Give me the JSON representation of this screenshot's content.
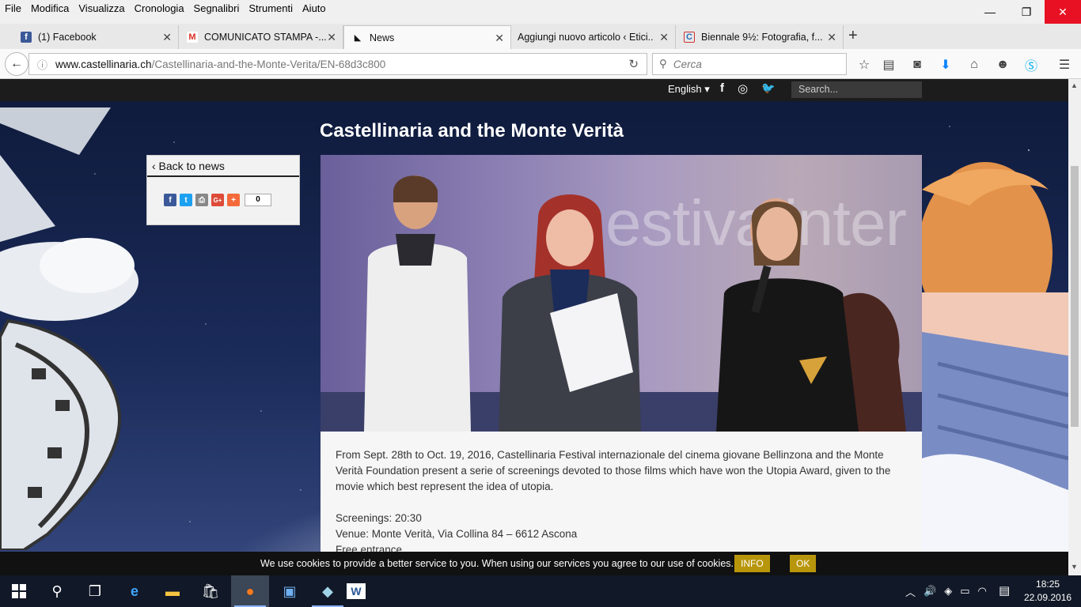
{
  "menubar": {
    "items": [
      "File",
      "Modifica",
      "Visualizza",
      "Cronologia",
      "Segnalibri",
      "Strumenti",
      "Aiuto"
    ]
  },
  "window_controls": {
    "minimize": "—",
    "maximize": "❐",
    "close": "✕"
  },
  "tabs": [
    {
      "title": "(1) Facebook",
      "favicon": "facebook-icon",
      "fav_glyph": "f",
      "fav_color": "#3b5998",
      "active": false
    },
    {
      "title": "COMUNICATO STAMPA -...",
      "favicon": "gmail-icon",
      "fav_glyph": "M",
      "fav_color": "#ffffff",
      "active": false
    },
    {
      "title": "News",
      "favicon": "castellinaria-icon",
      "fav_glyph": "◣",
      "fav_color": "#ffffff",
      "active": true
    },
    {
      "title": "Aggiungi nuovo articolo ‹ Etici...",
      "favicon": "",
      "fav_glyph": "",
      "fav_color": "",
      "active": false
    },
    {
      "title": "Biennale 9½: Fotografia, f...",
      "favicon": "biennale-icon",
      "fav_glyph": "C",
      "fav_color": "#ffffff",
      "active": false
    }
  ],
  "tab_close_glyph": "✕",
  "new_tab_glyph": "+",
  "navbar": {
    "url_host": "www.castellinaria.ch",
    "url_path": "/Castellinaria-and-the-Monte-Verita/EN-68d3c800",
    "search_placeholder": "Cerca"
  },
  "site": {
    "language": "English ▾",
    "search_placeholder": "Search...",
    "social": [
      "f",
      "◎",
      "🐦"
    ]
  },
  "article": {
    "title": "Castellinaria and the Monte Verità",
    "back_to_news": "‹ Back to news",
    "share_count": "0",
    "share_buttons": [
      {
        "label": "f",
        "color": "#3b5998",
        "icon": "facebook-share-icon"
      },
      {
        "label": "t",
        "color": "#1da1f2",
        "icon": "twitter-share-icon"
      },
      {
        "label": "⎙",
        "color": "#888888",
        "icon": "print-share-icon"
      },
      {
        "label": "G+",
        "color": "#dd4b39",
        "icon": "googleplus-share-icon"
      },
      {
        "label": "+",
        "color": "#f56a3a",
        "icon": "addthis-share-icon"
      }
    ],
    "photo_backdrop_text": "estivalinter",
    "paragraph1": "From Sept. 28th to Oct. 19, 2016, Castellinaria Festival internazionale del cinema giovane Bellinzona and the Monte Verità Foundation present a serie of screenings devoted to those films which have won the Utopia Award, given to the movie which best represent the idea of utopia.",
    "line_screenings": "Screenings: 20:30",
    "line_venue": "Venue: Monte Verità, Via Collina 84 – 6612 Ascona",
    "line_entrance": "Free entrance"
  },
  "cookie": {
    "text": "We use cookies to provide a better service to you. When using our services you agree to our use of cookies.",
    "info": "INFO",
    "ok": "OK"
  },
  "taskbar": {
    "time": "18:25",
    "date": "22.09.2016"
  },
  "colors": {
    "accent_cookie": "#b8960b",
    "close_button": "#e81123",
    "site_topbar": "#1c1c1c"
  }
}
